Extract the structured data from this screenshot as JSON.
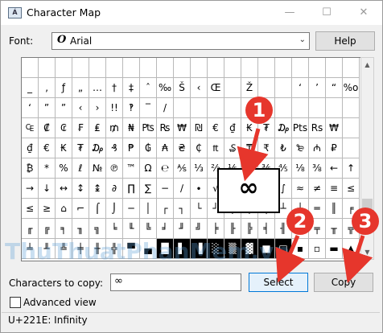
{
  "window": {
    "title": "Character Map",
    "app_icon": "charmap-app-icon"
  },
  "titlebar_buttons": {
    "minimize": "—",
    "maximize": "☐",
    "close": "✕"
  },
  "font": {
    "label": "Font:",
    "value": "Arial",
    "font_icon": "O"
  },
  "help_label": "Help",
  "zoom_glyph": "∞",
  "copy": {
    "label": "Characters to copy:",
    "value": "∞"
  },
  "select_label": "Select",
  "copy_label": "Copy",
  "advanced_view_label": "Advanced view",
  "advanced_view_checked": false,
  "status_text": "U+221E: Infinity",
  "watermark_text": "ThuThuatPhanMem.vn",
  "callouts": [
    "1",
    "2",
    "3"
  ],
  "callout_color": "#e6362c",
  "accent_color": "#0078d7",
  "scrollbar": {
    "up": "▲",
    "down": "▼"
  },
  "grid_rows": [
    [
      "",
      "",
      "",
      "",
      "",
      "",
      "",
      "",
      "",
      "",
      "",
      "",
      "",
      "",
      "",
      "",
      "",
      "",
      "",
      ""
    ],
    [
      "_",
      "‚",
      "ƒ",
      "„",
      "…",
      "†",
      "‡",
      "ˆ",
      "‰",
      "Š",
      "‹",
      "Œ",
      "",
      "Ž",
      "",
      "",
      "‘",
      "’",
      "“",
      "%o"
    ],
    [
      "‘",
      "”",
      "”",
      "‹",
      "›",
      "!!",
      "‽",
      "‾",
      "/",
      "",
      "",
      "",
      "",
      "",
      "",
      "",
      "",
      "",
      "",
      ""
    ],
    [
      "₠",
      "₡",
      "₢",
      "₣",
      "₤",
      "₥",
      "₦",
      "₧",
      "₨",
      "₩",
      "₪",
      "€",
      "₫",
      "₭",
      "₮",
      "₯",
      "Pts",
      "Rs",
      "₩",
      ""
    ],
    [
      "₫",
      "€",
      "₭",
      "₮",
      "₯",
      "₰",
      "₱",
      "₲",
      "₳",
      "₴",
      "₵",
      "₶",
      "₷",
      "₸",
      "₹",
      "₺",
      "₻",
      "₼",
      "₽",
      ""
    ],
    [
      "₿",
      "*",
      "%",
      "ℓ",
      "№",
      "℗",
      "™",
      "Ω",
      "℮",
      "⅍",
      "⅓",
      "⅔",
      "⅕",
      "⅖",
      "⅗",
      "⅘",
      "⅛",
      "⅜",
      "←",
      "↑"
    ],
    [
      "→",
      "↓",
      "↔",
      "↕",
      "↨",
      "∂",
      "∏",
      "∑",
      "−",
      "∕",
      "∙",
      "√",
      "∞",
      "∟",
      "∩",
      "∫",
      "≈",
      "≠",
      "≡",
      "≤"
    ],
    [
      "≤",
      "≥",
      "⌂",
      "⌐",
      "⌠",
      "⌡",
      "─",
      "│",
      "┌",
      "┐",
      "└",
      "┘",
      "├",
      "┤",
      "┬",
      "┴",
      "┼",
      "═",
      "║",
      "╒"
    ],
    [
      "╓",
      "╔",
      "╕",
      "╖",
      "╗",
      "╘",
      "╙",
      "╚",
      "╛",
      "╜",
      "╝",
      "╞",
      "╟",
      "╠",
      "╡",
      "╢",
      "╣",
      "╤",
      "╥",
      "╦"
    ],
    [
      "╧",
      "╨",
      "╩",
      "╪",
      "╫",
      "╬",
      "▀",
      "▄",
      "█",
      "▌",
      "▐",
      "░",
      "▒",
      "▓",
      "■",
      "□",
      "▪",
      "▫",
      "▬",
      "▲"
    ]
  ]
}
